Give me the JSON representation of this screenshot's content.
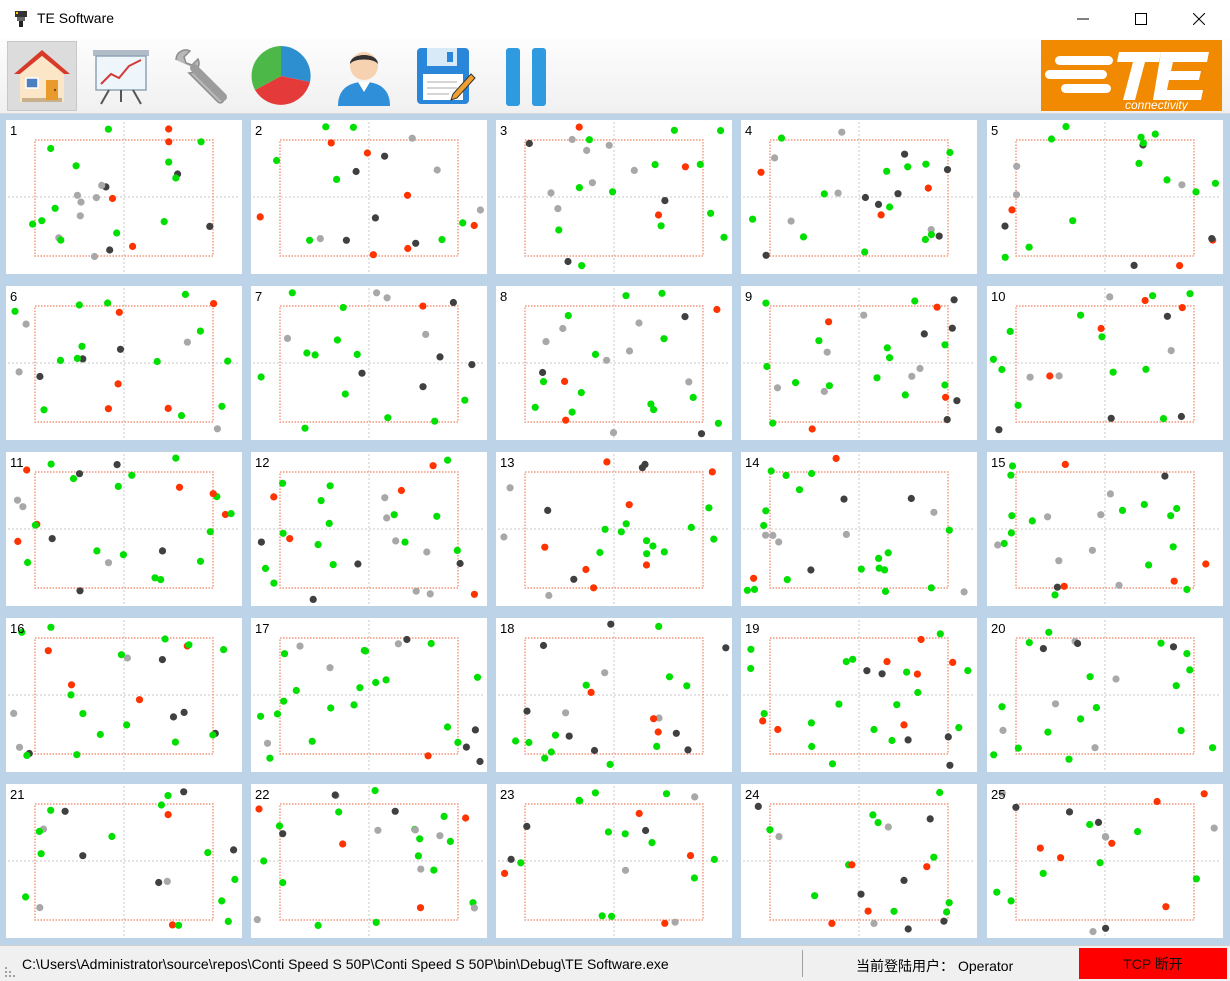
{
  "window": {
    "title": "TE Software"
  },
  "toolbar": {
    "items": [
      {
        "name": "home",
        "icon": "home-icon"
      },
      {
        "name": "chart",
        "icon": "line-chart-board-icon"
      },
      {
        "name": "settings",
        "icon": "wrench-icon"
      },
      {
        "name": "statistics",
        "icon": "pie-chart-icon"
      },
      {
        "name": "user",
        "icon": "user-icon"
      },
      {
        "name": "save",
        "icon": "save-edit-icon"
      },
      {
        "name": "pause",
        "icon": "pause-icon"
      }
    ],
    "logo": {
      "icon": "te-connectivity-logo",
      "text": "connectivity",
      "color": "#f18a00"
    }
  },
  "panels": [
    {
      "num": "1"
    },
    {
      "num": "2"
    },
    {
      "num": "3"
    },
    {
      "num": "4"
    },
    {
      "num": "5"
    },
    {
      "num": "6"
    },
    {
      "num": "7"
    },
    {
      "num": "8"
    },
    {
      "num": "9"
    },
    {
      "num": "10"
    },
    {
      "num": "11"
    },
    {
      "num": "12"
    },
    {
      "num": "13"
    },
    {
      "num": "14"
    },
    {
      "num": "15"
    },
    {
      "num": "16"
    },
    {
      "num": "17"
    },
    {
      "num": "18"
    },
    {
      "num": "19"
    },
    {
      "num": "20"
    },
    {
      "num": "21"
    },
    {
      "num": "22"
    },
    {
      "num": "23"
    },
    {
      "num": "24"
    },
    {
      "num": "25"
    }
  ],
  "colors": {
    "green": "#00e000",
    "red": "#ff3300",
    "dark": "#404040",
    "gray": "#a8a8a8",
    "frame": "#f08060",
    "grid_bg": "#bcd3e8"
  },
  "status": {
    "path": "C:\\Users\\Administrator\\source\\repos\\Conti Speed S 50P\\Conti Speed S 50P\\bin\\Debug\\TE Software.exe",
    "user_label": "当前登陆用户：",
    "user_value": "Operator",
    "tcp": "TCP 断开",
    "tcp_color": "#ff0000"
  }
}
